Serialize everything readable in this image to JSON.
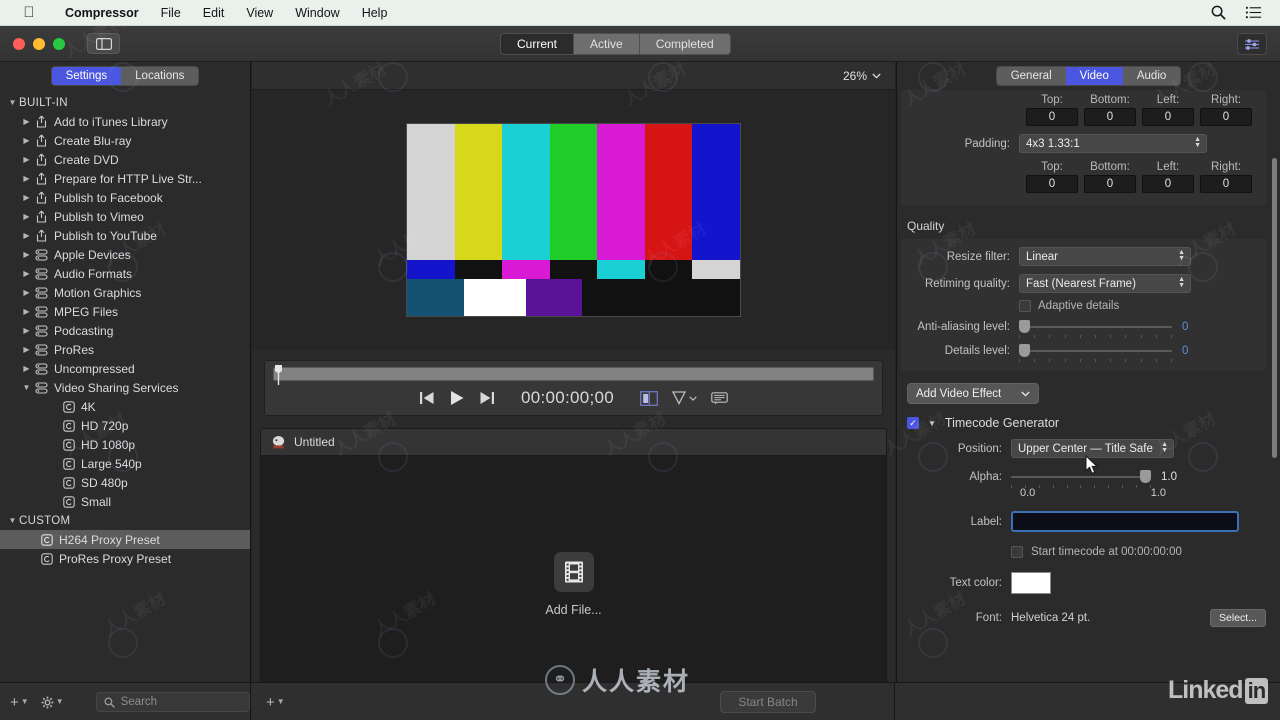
{
  "menubar": {
    "apple_icon": "apple-logo",
    "items": [
      "Compressor",
      "File",
      "Edit",
      "View",
      "Window",
      "Help"
    ],
    "right_icons": [
      "search-icon",
      "list-icon"
    ]
  },
  "toolbar": {
    "sidebar_toggle_icon": "sidebar-toggle-icon",
    "segments": [
      {
        "label": "Current",
        "active": true
      },
      {
        "label": "Active",
        "active": false
      },
      {
        "label": "Completed",
        "active": false
      }
    ],
    "inspector_toggle_icon": "inspector-toggle-icon"
  },
  "sidebar": {
    "tabs": [
      {
        "label": "Settings",
        "active": true
      },
      {
        "label": "Locations",
        "active": false
      }
    ],
    "groups": [
      {
        "label": "BUILT-IN",
        "expanded": true,
        "items": [
          {
            "label": "Add to iTunes Library",
            "icon": "share-icon",
            "disclosure": "collapsed"
          },
          {
            "label": "Create Blu-ray",
            "icon": "share-icon",
            "disclosure": "collapsed"
          },
          {
            "label": "Create DVD",
            "icon": "share-icon",
            "disclosure": "collapsed"
          },
          {
            "label": "Prepare for HTTP Live Str...",
            "icon": "share-icon",
            "disclosure": "collapsed"
          },
          {
            "label": "Publish to Facebook",
            "icon": "share-icon",
            "disclosure": "collapsed"
          },
          {
            "label": "Publish to Vimeo",
            "icon": "share-icon",
            "disclosure": "collapsed"
          },
          {
            "label": "Publish to YouTube",
            "icon": "share-icon",
            "disclosure": "collapsed"
          },
          {
            "label": "Apple Devices",
            "icon": "stack-icon",
            "disclosure": "collapsed"
          },
          {
            "label": "Audio Formats",
            "icon": "stack-icon",
            "disclosure": "collapsed"
          },
          {
            "label": "Motion Graphics",
            "icon": "stack-icon",
            "disclosure": "collapsed"
          },
          {
            "label": "MPEG Files",
            "icon": "stack-icon",
            "disclosure": "collapsed"
          },
          {
            "label": "Podcasting",
            "icon": "stack-icon",
            "disclosure": "collapsed"
          },
          {
            "label": "ProRes",
            "icon": "stack-icon",
            "disclosure": "collapsed"
          },
          {
            "label": "Uncompressed",
            "icon": "stack-icon",
            "disclosure": "collapsed"
          },
          {
            "label": "Video Sharing Services",
            "icon": "stack-icon",
            "disclosure": "expanded"
          }
        ],
        "children": [
          {
            "label": "4K",
            "icon": "setting-icon"
          },
          {
            "label": "HD 720p",
            "icon": "setting-icon"
          },
          {
            "label": "HD 1080p",
            "icon": "setting-icon"
          },
          {
            "label": "Large 540p",
            "icon": "setting-icon"
          },
          {
            "label": "SD 480p",
            "icon": "setting-icon"
          },
          {
            "label": "Small",
            "icon": "setting-icon"
          }
        ]
      },
      {
        "label": "CUSTOM",
        "expanded": true,
        "items": [
          {
            "label": "H264 Proxy Preset",
            "icon": "setting-icon",
            "selected": true
          },
          {
            "label": "ProRes Proxy Preset",
            "icon": "setting-icon",
            "selected": false
          }
        ]
      }
    ]
  },
  "bottombar": {
    "add_setting_icon": "plus-icon",
    "action_icon": "gear-icon",
    "search_placeholder": "Search",
    "search_value": "",
    "add_batch_icon": "plus-icon",
    "start_batch_label": "Start Batch"
  },
  "preview": {
    "zoom_level": "26%",
    "zoom_caret": "chevron-down-icon",
    "pattern": "smpte-color-bars",
    "bars_top": [
      "#d4d4d4",
      "#d8d81b",
      "#1ad0d4",
      "#1fcc28",
      "#d81ad4",
      "#d61414",
      "#1414cc"
    ],
    "bars_mid": [
      "#1414cc",
      "#111111",
      "#d81ad4",
      "#111111",
      "#1ad0d4",
      "#111111",
      "#d4d4d4"
    ],
    "bars_bot": [
      "#145273",
      "#ffffff",
      "#5a1299",
      "#111111",
      "#111111"
    ],
    "transport": {
      "prev_icon": "skip-back-icon",
      "play_icon": "play-icon",
      "next_icon": "skip-forward-icon",
      "timecode": "00:00:00;00",
      "split_view_icon": "split-view-icon",
      "mask_icon": "mask-icon",
      "mask_caret": "chevron-down-icon",
      "caption_icon": "caption-icon"
    }
  },
  "batch": {
    "icon": "batch-icon",
    "title": "Untitled",
    "empty_icon": "film-strip-icon",
    "empty_label": "Add File..."
  },
  "inspector": {
    "tabs": [
      {
        "label": "General",
        "active": false
      },
      {
        "label": "Video",
        "active": true
      },
      {
        "label": "Audio",
        "active": false
      }
    ],
    "crop": {
      "edge_labels": [
        "Top:",
        "Bottom:",
        "Left:",
        "Right:"
      ],
      "values": [
        "0",
        "0",
        "0",
        "0"
      ]
    },
    "padding": {
      "label": "Padding:",
      "value": "4x3 1.33:1",
      "edge_labels": [
        "Top:",
        "Bottom:",
        "Left:",
        "Right:"
      ],
      "values": [
        "0",
        "0",
        "0",
        "0"
      ]
    },
    "quality": {
      "title": "Quality",
      "resize_filter_label": "Resize filter:",
      "resize_filter_value": "Linear",
      "retiming_label": "Retiming quality:",
      "retiming_value": "Fast (Nearest Frame)",
      "adaptive_label": "Adaptive details",
      "adaptive_checked": false,
      "antialias_label": "Anti-aliasing level:",
      "antialias_value": "0",
      "details_label": "Details level:",
      "details_value": "0"
    },
    "add_effect": {
      "label": "Add Video Effect",
      "caret": "chevron-down-icon"
    },
    "timecode_generator": {
      "title": "Timecode Generator",
      "enabled": true,
      "disclosure": "expanded",
      "position_label": "Position:",
      "position_value": "Upper Center — Title Safe",
      "alpha_label": "Alpha:",
      "alpha_value": "1.0",
      "alpha_min": "0.0",
      "alpha_max": "1.0",
      "label_label": "Label:",
      "label_value": "",
      "start_timecode_label": "Start timecode at 00:00:00:00",
      "start_timecode_checked": false,
      "text_color_label": "Text color:",
      "text_color_value": "#ffffff",
      "font_label": "Font:",
      "font_value": "Helvetica 24 pt.",
      "select_label": "Select..."
    }
  },
  "watermark": {
    "center_text": "人人素材",
    "linkedin_text": "Linked",
    "linkedin_badge": "in"
  }
}
